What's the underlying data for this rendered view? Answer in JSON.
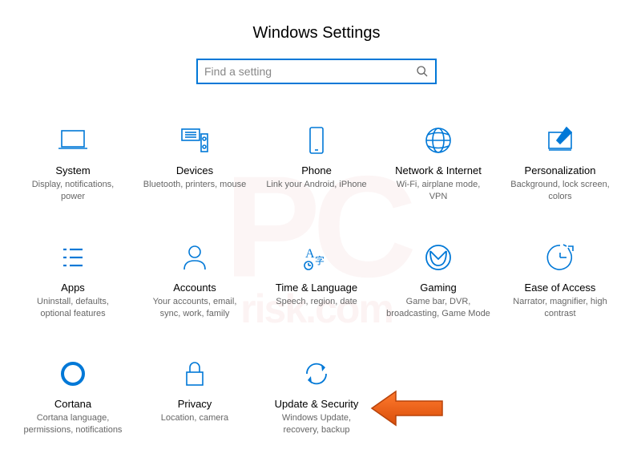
{
  "page_title": "Windows Settings",
  "search": {
    "placeholder": "Find a setting"
  },
  "tiles": [
    {
      "title": "System",
      "desc": "Display, notifications, power"
    },
    {
      "title": "Devices",
      "desc": "Bluetooth, printers, mouse"
    },
    {
      "title": "Phone",
      "desc": "Link your Android, iPhone"
    },
    {
      "title": "Network & Internet",
      "desc": "Wi-Fi, airplane mode, VPN"
    },
    {
      "title": "Personalization",
      "desc": "Background, lock screen, colors"
    },
    {
      "title": "Apps",
      "desc": "Uninstall, defaults, optional features"
    },
    {
      "title": "Accounts",
      "desc": "Your accounts, email, sync, work, family"
    },
    {
      "title": "Time & Language",
      "desc": "Speech, region, date"
    },
    {
      "title": "Gaming",
      "desc": "Game bar, DVR, broadcasting, Game Mode"
    },
    {
      "title": "Ease of Access",
      "desc": "Narrator, magnifier, high contrast"
    },
    {
      "title": "Cortana",
      "desc": "Cortana language, permissions, notifications"
    },
    {
      "title": "Privacy",
      "desc": "Location, camera"
    },
    {
      "title": "Update & Security",
      "desc": "Windows Update, recovery, backup"
    }
  ]
}
